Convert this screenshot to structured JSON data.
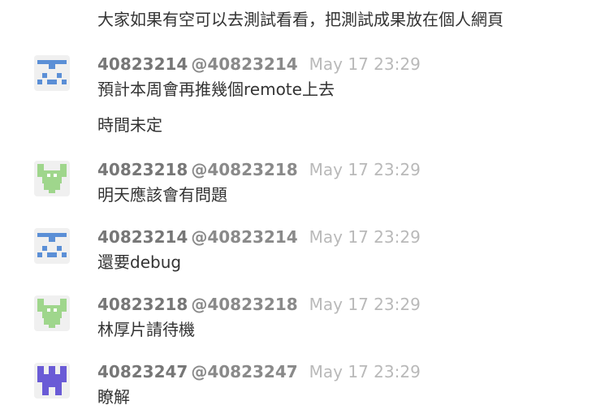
{
  "colors": {
    "author_text": "#777777",
    "username_text": "#8a8a8a",
    "time_text": "#b9b9b9",
    "message_text": "#333333",
    "avatar_blue": "#5b8fd6",
    "avatar_green": "#9fd68c",
    "avatar_purple": "#6a5bd6"
  },
  "continuation": {
    "text": "大家如果有空可以去測試看看，把測試成果放在個人網頁"
  },
  "messages": [
    {
      "author": "40823214",
      "username": "@40823214",
      "time": "May 17 23:29",
      "avatar_icon": "identicon-blue-avatar",
      "lines": [
        "預計本周會再推幾個remote上去",
        "時間未定"
      ]
    },
    {
      "author": "40823218",
      "username": "@40823218",
      "time": "May 17 23:29",
      "avatar_icon": "identicon-green-avatar",
      "lines": [
        "明天應該會有問題"
      ]
    },
    {
      "author": "40823214",
      "username": "@40823214",
      "time": "May 17 23:29",
      "avatar_icon": "identicon-blue-avatar",
      "lines": [
        "還要debug"
      ]
    },
    {
      "author": "40823218",
      "username": "@40823218",
      "time": "May 17 23:29",
      "avatar_icon": "identicon-green-avatar",
      "lines": [
        "林厚片請待機"
      ]
    },
    {
      "author": "40823247",
      "username": "@40823247",
      "time": "May 17 23:29",
      "avatar_icon": "identicon-purple-avatar",
      "lines": [
        "瞭解"
      ]
    }
  ]
}
